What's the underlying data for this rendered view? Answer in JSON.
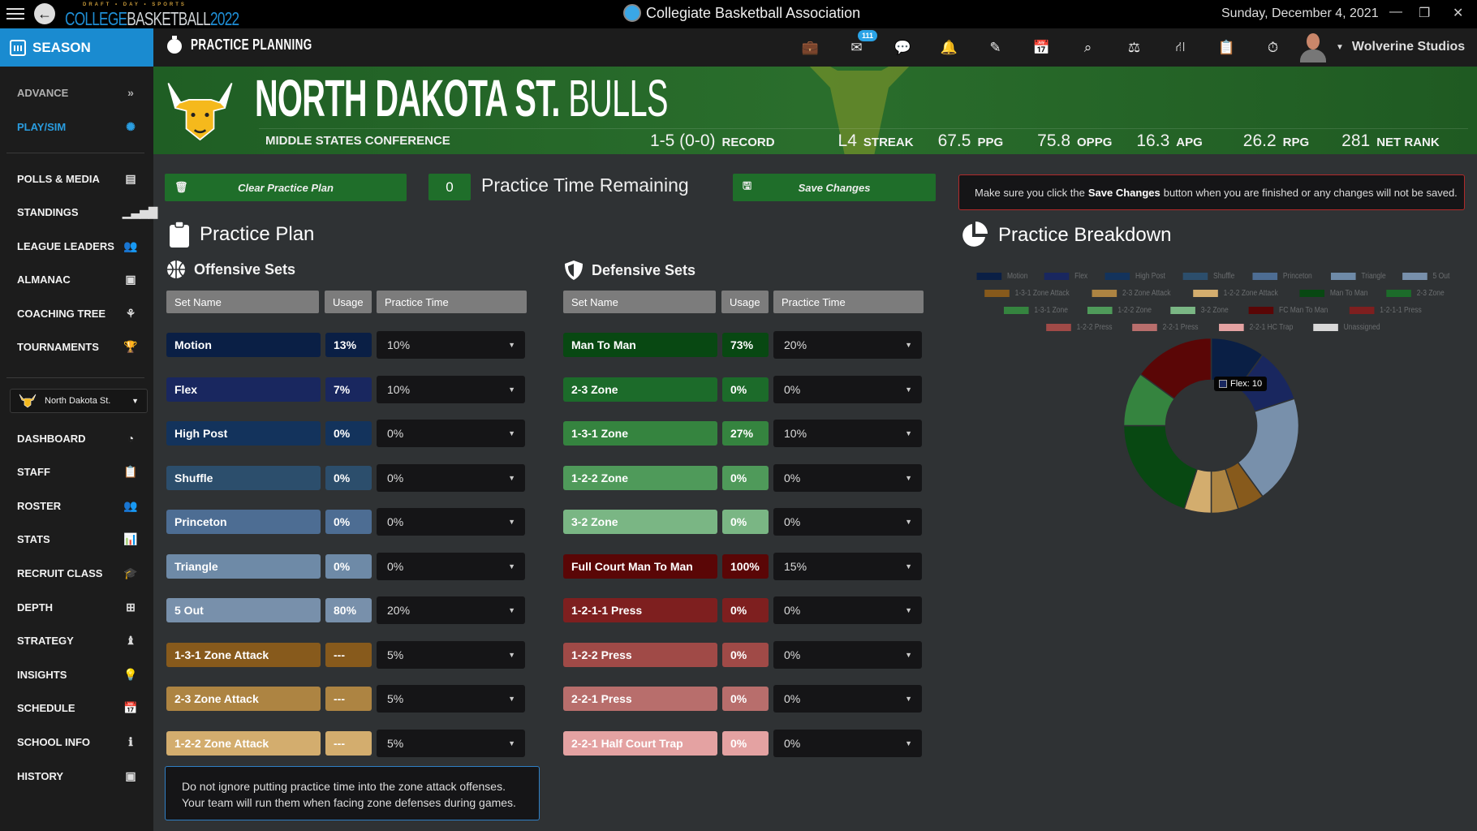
{
  "titlebar": {
    "logo_top": "DRAFT • DAY • SPORTS",
    "logo_part1": "COLLEGE",
    "logo_part2": "BASKETBALL",
    "logo_part3": "2022",
    "center_title": "Collegiate Basketball Association",
    "date": "Sunday, December 4, 2021",
    "minimize": "—",
    "restore": "❐",
    "close": "✕"
  },
  "navbar": {
    "section": "SEASON",
    "page_title": "PRACTICE PLANNING",
    "mail_badge": "111",
    "icons": [
      {
        "name": "briefcase-icon",
        "glyph": "💼"
      },
      {
        "name": "mail-icon",
        "glyph": "✉"
      },
      {
        "name": "chat-icon",
        "glyph": "💬"
      },
      {
        "name": "bell-icon",
        "glyph": "🔔"
      },
      {
        "name": "edit-icon",
        "glyph": "✎"
      },
      {
        "name": "calendar-check-icon",
        "glyph": "📅"
      },
      {
        "name": "search-icon",
        "glyph": "⌕"
      },
      {
        "name": "scale-icon",
        "glyph": "⚖"
      },
      {
        "name": "road-icon",
        "glyph": "⛙"
      },
      {
        "name": "clipboard-icon",
        "glyph": "📋"
      },
      {
        "name": "stopwatch-icon",
        "glyph": "⏱"
      }
    ],
    "user_name": "Wolverine Studios"
  },
  "sidebar": {
    "top_items": [
      {
        "label": "ADVANCE",
        "icon": "»",
        "icon_name": "double-chevron-icon",
        "color": "#b0b0b0"
      },
      {
        "label": "PLAY/SIM",
        "icon": "✺",
        "icon_name": "basketball-icon",
        "color": "#2a9de0"
      }
    ],
    "middle_items": [
      {
        "label": "POLLS & MEDIA",
        "icon": "▤",
        "icon_name": "newspaper-icon"
      },
      {
        "label": "STANDINGS",
        "icon": "▁▃▅▇",
        "icon_name": "signal-bars-icon"
      },
      {
        "label": "LEAGUE LEADERS",
        "icon": "👥",
        "icon_name": "users-icon"
      },
      {
        "label": "ALMANAC",
        "icon": "▣",
        "icon_name": "archive-icon"
      },
      {
        "label": "COACHING TREE",
        "icon": "⚘",
        "icon_name": "tree-icon"
      },
      {
        "label": "TOURNAMENTS",
        "icon": "🏆",
        "icon_name": "trophy-icon"
      }
    ],
    "team_selector": "North Dakota St.",
    "bottom_items": [
      {
        "label": "DASHBOARD",
        "icon": "◔",
        "icon_name": "gauge-icon"
      },
      {
        "label": "STAFF",
        "icon": "📋",
        "icon_name": "clipboard-icon"
      },
      {
        "label": "ROSTER",
        "icon": "👥",
        "icon_name": "team-icon"
      },
      {
        "label": "STATS",
        "icon": "📊",
        "icon_name": "chart-icon"
      },
      {
        "label": "RECRUIT CLASS",
        "icon": "🎓",
        "icon_name": "graduate-icon"
      },
      {
        "label": "DEPTH",
        "icon": "⊞",
        "icon_name": "hierarchy-icon"
      },
      {
        "label": "STRATEGY",
        "icon": "♝",
        "icon_name": "chess-icon"
      },
      {
        "label": "INSIGHTS",
        "icon": "💡",
        "icon_name": "lightbulb-icon"
      },
      {
        "label": "SCHEDULE",
        "icon": "📅",
        "icon_name": "calendar-icon"
      },
      {
        "label": "SCHOOL INFO",
        "icon": "ℹ",
        "icon_name": "info-icon"
      },
      {
        "label": "HISTORY",
        "icon": "▣",
        "icon_name": "archive-icon"
      }
    ]
  },
  "team": {
    "name_bold": "NORTH DAKOTA ST.",
    "name_thin": "BULLS",
    "conference": "MIDDLE STATES CONFERENCE",
    "stats": [
      {
        "value": "1-5 (0-0)",
        "label": "RECORD"
      },
      {
        "value": "L4",
        "label": "STREAK"
      },
      {
        "value": "67.5",
        "label": "PPG"
      },
      {
        "value": "75.8",
        "label": "OPPG"
      },
      {
        "value": "16.3",
        "label": "APG"
      },
      {
        "value": "26.2",
        "label": "RPG"
      },
      {
        "value": "281",
        "label": "NET RANK"
      }
    ]
  },
  "controls": {
    "clear_label": "Clear Practice Plan",
    "time_remaining_value": "0",
    "time_remaining_label": "Practice Time Remaining",
    "save_label": "Save Changes",
    "notice_pre": "Make sure you click the",
    "notice_bold": "Save Changes",
    "notice_post": "button when you are finished or any changes will not be saved."
  },
  "practice_plan": {
    "title": "Practice Plan",
    "headers": {
      "set_name": "Set Name",
      "usage": "Usage",
      "practice_time": "Practice Time"
    },
    "offense_title": "Offensive Sets",
    "defense_title": "Defensive Sets",
    "offense": [
      {
        "name": "Motion",
        "usage": "13%",
        "time": "10%",
        "color": "#0a1f45"
      },
      {
        "name": "Flex",
        "usage": "7%",
        "time": "10%",
        "color": "#19275f"
      },
      {
        "name": "High Post",
        "usage": "0%",
        "time": "0%",
        "color": "#13335c"
      },
      {
        "name": "Shuffle",
        "usage": "0%",
        "time": "0%",
        "color": "#2c4e6c"
      },
      {
        "name": "Princeton",
        "usage": "0%",
        "time": "0%",
        "color": "#4d6d93"
      },
      {
        "name": "Triangle",
        "usage": "0%",
        "time": "0%",
        "color": "#6e8aa7"
      },
      {
        "name": "5 Out",
        "usage": "80%",
        "time": "20%",
        "color": "#7890ab"
      },
      {
        "name": "1-3-1 Zone Attack",
        "usage": "---",
        "time": "5%",
        "color": "#875a1c"
      },
      {
        "name": "2-3 Zone Attack",
        "usage": "---",
        "time": "5%",
        "color": "#ad8442"
      },
      {
        "name": "1-2-2 Zone Attack",
        "usage": "---",
        "time": "5%",
        "color": "#d3ad6e"
      }
    ],
    "defense": [
      {
        "name": "Man To Man",
        "usage": "73%",
        "time": "20%",
        "color": "#084812"
      },
      {
        "name": "2-3 Zone",
        "usage": "0%",
        "time": "0%",
        "color": "#1c6b2a"
      },
      {
        "name": "1-3-1 Zone",
        "usage": "27%",
        "time": "10%",
        "color": "#35843f"
      },
      {
        "name": "1-2-2 Zone",
        "usage": "0%",
        "time": "0%",
        "color": "#4f9a5a"
      },
      {
        "name": "3-2 Zone",
        "usage": "0%",
        "time": "0%",
        "color": "#7ab684"
      },
      {
        "name": "Full Court Man To Man",
        "usage": "100%",
        "time": "15%",
        "color": "#5a0606"
      },
      {
        "name": "1-2-1-1 Press",
        "usage": "0%",
        "time": "0%",
        "color": "#7e1f1f"
      },
      {
        "name": "1-2-2 Press",
        "usage": "0%",
        "time": "0%",
        "color": "#a04a47"
      },
      {
        "name": "2-2-1 Press",
        "usage": "0%",
        "time": "0%",
        "color": "#b86e6c"
      },
      {
        "name": "2-2-1 Half Court Trap",
        "usage": "0%",
        "time": "0%",
        "color": "#e4a2a2"
      }
    ],
    "tip_line1": "Do not ignore putting practice time into the zone attack offenses.",
    "tip_line2": "Your team will run them when facing zone defenses during games."
  },
  "chart_data": {
    "type": "pie",
    "title": "Practice Breakdown",
    "donut": true,
    "legend_position": "top",
    "legend": [
      {
        "label": "Motion",
        "color": "#0a1f45"
      },
      {
        "label": "Flex",
        "color": "#19275f"
      },
      {
        "label": "High Post",
        "color": "#13335c"
      },
      {
        "label": "Shuffle",
        "color": "#2c4e6c"
      },
      {
        "label": "Princeton",
        "color": "#4d6d93"
      },
      {
        "label": "Triangle",
        "color": "#6e8aa7"
      },
      {
        "label": "5 Out",
        "color": "#7890ab"
      },
      {
        "label": "1-3-1 Zone Attack",
        "color": "#875a1c"
      },
      {
        "label": "2-3 Zone Attack",
        "color": "#ad8442"
      },
      {
        "label": "1-2-2 Zone Attack",
        "color": "#d3ad6e"
      },
      {
        "label": "Man To Man",
        "color": "#084812"
      },
      {
        "label": "2-3 Zone",
        "color": "#1c6b2a"
      },
      {
        "label": "1-3-1 Zone",
        "color": "#35843f"
      },
      {
        "label": "1-2-2 Zone",
        "color": "#4f9a5a"
      },
      {
        "label": "3-2 Zone",
        "color": "#7ab684"
      },
      {
        "label": "FC Man To Man",
        "color": "#5a0606"
      },
      {
        "label": "1-2-1-1 Press",
        "color": "#7e1f1f"
      },
      {
        "label": "1-2-2 Press",
        "color": "#a04a47"
      },
      {
        "label": "2-2-1 Press",
        "color": "#b86e6c"
      },
      {
        "label": "2-2-1 HC Trap",
        "color": "#e4a2a2"
      },
      {
        "label": "Unassigned",
        "color": "#d8d8d8"
      }
    ],
    "legend_rows": [
      7,
      5,
      5,
      4
    ],
    "slices": [
      {
        "label": "Motion",
        "value": 10
      },
      {
        "label": "Flex",
        "value": 10
      },
      {
        "label": "5 Out",
        "value": 20
      },
      {
        "label": "1-3-1 Zone Attack",
        "value": 5
      },
      {
        "label": "2-3 Zone Attack",
        "value": 5
      },
      {
        "label": "1-2-2 Zone Attack",
        "value": 5
      },
      {
        "label": "Man To Man",
        "value": 20
      },
      {
        "label": "1-3-1 Zone",
        "value": 10
      },
      {
        "label": "FC Man To Man",
        "value": 15
      }
    ],
    "tooltip": {
      "label": "Flex",
      "value": 10,
      "text": "Flex: 10"
    }
  }
}
